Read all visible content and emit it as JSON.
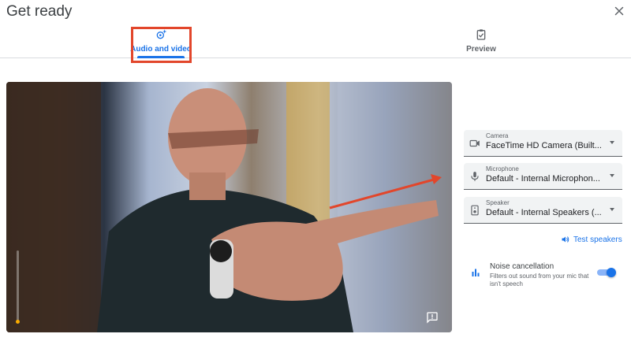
{
  "window": {
    "title": "Get ready"
  },
  "tabs": [
    {
      "label": "Audio and video",
      "icon": "settings-sparkle-icon",
      "active": true
    },
    {
      "label": "Preview",
      "icon": "clipboard-check-icon",
      "active": false
    }
  ],
  "devices": {
    "camera": {
      "label": "Camera",
      "value": "FaceTime HD Camera (Built-in)",
      "icon": "videocam-icon"
    },
    "microphone": {
      "label": "Microphone",
      "value": "Default - Internal Microphone (Built-in)",
      "icon": "mic-icon"
    },
    "speaker": {
      "label": "Speaker",
      "value": "Default - Internal Speakers (Built-in)",
      "icon": "speaker-icon"
    }
  },
  "test_speakers": {
    "label": "Test speakers",
    "icon": "volume-icon"
  },
  "noise_cancellation": {
    "title": "Noise cancellation",
    "description": "Filters out sound from your mic that isn't speech",
    "enabled": true,
    "icon": "bar-chart-icon"
  },
  "colors": {
    "accent": "#1a73e8",
    "highlight": "#e2462b",
    "arrow": "#e2462b"
  }
}
